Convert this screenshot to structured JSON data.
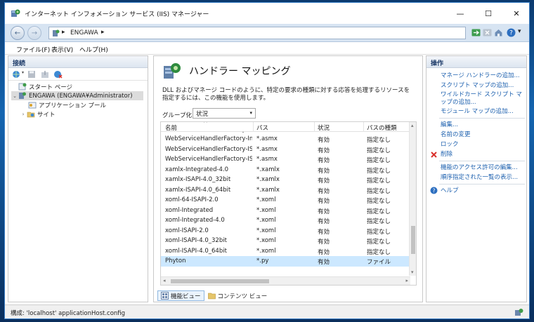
{
  "window": {
    "title": "インターネット インフォメーション サービス (IIS) マネージャー",
    "minimize": "—",
    "maximize": "☐",
    "close": "✕"
  },
  "address": {
    "back": "←",
    "forward": "→",
    "separator": "▸",
    "path": "ENGAWA",
    "help_caret": "▾"
  },
  "menu": {
    "file": "ファイル(F)",
    "view": "表示(V)",
    "help": "ヘルプ(H)"
  },
  "connections": {
    "header": "接続",
    "tree": [
      {
        "label": "スタート ページ"
      },
      {
        "label": "ENGAWA (ENGAWA¥Administrator)",
        "expander": "⌄"
      },
      {
        "label": "アプリケーション プール"
      },
      {
        "label": "サイト",
        "expander": "›"
      }
    ]
  },
  "center": {
    "title": "ハンドラー マッピング",
    "description": "DLL およびマネージ コードのように、特定の要求の種類に対する応答を処理するリソースを指定するには、この機能を使用します。",
    "group_label": "グループ化:",
    "group_value": "状況",
    "group_caret": "▾",
    "sort_caret": "^",
    "columns": {
      "name": "名前",
      "path": "パス",
      "state": "状況",
      "path_type": "パスの種類"
    },
    "rows": [
      {
        "name": "WebServiceHandlerFactory-Int...",
        "path": "*.asmx",
        "state": "有効",
        "type": "指定なし"
      },
      {
        "name": "WebServiceHandlerFactory-IS...",
        "path": "*.asmx",
        "state": "有効",
        "type": "指定なし"
      },
      {
        "name": "WebServiceHandlerFactory-IS...",
        "path": "*.asmx",
        "state": "有効",
        "type": "指定なし"
      },
      {
        "name": "xamlx-Integrated-4.0",
        "path": "*.xamlx",
        "state": "有効",
        "type": "指定なし"
      },
      {
        "name": "xamlx-ISAPI-4.0_32bit",
        "path": "*.xamlx",
        "state": "有効",
        "type": "指定なし"
      },
      {
        "name": "xamlx-ISAPI-4.0_64bit",
        "path": "*.xamlx",
        "state": "有効",
        "type": "指定なし"
      },
      {
        "name": "xoml-64-ISAPI-2.0",
        "path": "*.xoml",
        "state": "有効",
        "type": "指定なし"
      },
      {
        "name": "xoml-Integrated",
        "path": "*.xoml",
        "state": "有効",
        "type": "指定なし"
      },
      {
        "name": "xoml-Integrated-4.0",
        "path": "*.xoml",
        "state": "有効",
        "type": "指定なし"
      },
      {
        "name": "xoml-ISAPI-2.0",
        "path": "*.xoml",
        "state": "有効",
        "type": "指定なし"
      },
      {
        "name": "xoml-ISAPI-4.0_32bit",
        "path": "*.xoml",
        "state": "有効",
        "type": "指定なし"
      },
      {
        "name": "xoml-ISAPI-4.0_64bit",
        "path": "*.xoml",
        "state": "有効",
        "type": "指定なし"
      },
      {
        "name": "Phyton",
        "path": "*.py",
        "state": "有効",
        "type": "ファイル"
      }
    ],
    "scroll_up": "▴",
    "scroll_down": "▾",
    "scroll_left": "◂",
    "scroll_right": "▸",
    "tabs": {
      "features": "機能ビュー",
      "content": "コンテンツ ビュー"
    }
  },
  "actions": {
    "header": "操作",
    "items": [
      "マネージ ハンドラーの追加...",
      "スクリプト マップの追加...",
      "ワイルドカード スクリプト マップの追加...",
      "モジュール マップの追加...",
      "編集...",
      "名前の変更",
      "ロック",
      "削除",
      "機能のアクセス許可の編集...",
      "順序指定された一覧の表示...",
      "ヘルプ"
    ]
  },
  "status": {
    "text": "構成: 'localhost' applicationHost.config"
  },
  "colors": {
    "accent": "#1b5fae",
    "selection": "#cce8ff",
    "delete": "#d9302b"
  }
}
